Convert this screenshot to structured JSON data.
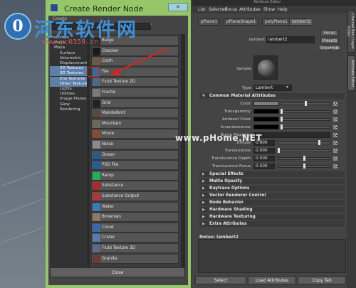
{
  "watermark": {
    "logo_char": "0",
    "text": "河东软件网",
    "url": "www.pc0359.cn",
    "center_text": "www.pHome.NET"
  },
  "render_node": {
    "title": "Create Render Node",
    "create_label": "Create",
    "close_label": "Close",
    "tree": [
      {
        "label": "Favorites",
        "level": 0,
        "selected": false
      },
      {
        "label": "Mava",
        "level": 1,
        "selected": false
      },
      {
        "label": "Maya",
        "level": 1,
        "selected": false
      },
      {
        "label": "Surface",
        "level": 2,
        "selected": false
      },
      {
        "label": "Volumetric",
        "level": 2,
        "selected": false
      },
      {
        "label": "Displacement",
        "level": 2,
        "selected": false
      },
      {
        "label": "2D Textures",
        "level": 2,
        "selected": true
      },
      {
        "label": "3D Textures",
        "level": 2,
        "selected": true
      },
      {
        "label": "Env Textures",
        "level": 2,
        "selected": true
      },
      {
        "label": "Other Textures",
        "level": 2,
        "selected": true
      },
      {
        "label": "Lights",
        "level": 2,
        "selected": false
      },
      {
        "label": "Utilities",
        "level": 2,
        "selected": false
      },
      {
        "label": "Image Planes",
        "level": 2,
        "selected": false
      },
      {
        "label": "Glow",
        "level": 2,
        "selected": false
      },
      {
        "label": "Rendering",
        "level": 2,
        "selected": false
      }
    ],
    "nodes": [
      {
        "label": "Bulge",
        "color": "#2a2a2a",
        "icon": "bulge-icon"
      },
      {
        "label": "Checker",
        "color": "#1a1a1a",
        "icon": "checker-icon"
      },
      {
        "label": "Cloth",
        "color": "#6a5a4a",
        "icon": "cloth-icon"
      },
      {
        "label": "File",
        "color": "#3a6a9a",
        "icon": "file-icon"
      },
      {
        "label": "Fluid Texture 2D",
        "color": "#4a6a8a",
        "icon": "fluid-icon"
      },
      {
        "label": "Fractal",
        "color": "#7a7a7a",
        "icon": "fractal-icon"
      },
      {
        "label": "Grid",
        "color": "#222222",
        "icon": "grid-icon"
      },
      {
        "label": "Mandelbrot",
        "color": "#5a4a3a",
        "icon": "mandelbrot-icon"
      },
      {
        "label": "Mountain",
        "color": "#6a6a5a",
        "icon": "mountain-icon"
      },
      {
        "label": "Movie",
        "color": "#8a4a3a",
        "icon": "movie-icon"
      },
      {
        "label": "Noise",
        "color": "#8a8a8a",
        "icon": "noise-icon"
      },
      {
        "label": "Ocean",
        "color": "#2a5a8a",
        "icon": "ocean-icon"
      },
      {
        "label": "PSD File",
        "color": "#2a5a9a",
        "icon": "psd-icon"
      },
      {
        "label": "Ramp",
        "color": "#2aaa5a",
        "icon": "ramp-icon"
      },
      {
        "label": "Substance",
        "color": "#aa2a2a",
        "icon": "substance-icon"
      },
      {
        "label": "Substance Output",
        "color": "#aa3a3a",
        "icon": "substance-output-icon"
      },
      {
        "label": "Water",
        "color": "#3a7aba",
        "icon": "water-icon"
      },
      {
        "label": "Brownian",
        "color": "#8a7a6a",
        "icon": "brownian-icon"
      },
      {
        "label": "Cloud",
        "color": "#3a6aaa",
        "icon": "cloud-icon"
      },
      {
        "label": "Crater",
        "color": "#5a7aaa",
        "icon": "crater-icon"
      },
      {
        "label": "Fluid Texture 3D",
        "color": "#5a6a8a",
        "icon": "fluid3d-icon"
      },
      {
        "label": "Granite",
        "color": "#6a3a3a",
        "icon": "granite-icon"
      }
    ]
  },
  "attribute_editor": {
    "title": "Attribute Editor",
    "menu": [
      "List",
      "Selected",
      "Focus",
      "Attributes",
      "Show",
      "Help"
    ],
    "tabs": [
      "pPlane1",
      "pPlaneShape1",
      "polyPlane1",
      "lambert2"
    ],
    "node_label": "lambert:",
    "node_value": "lambert2",
    "focus_label": "Focus",
    "presets_label": "Presets",
    "show_label": "Show",
    "hide_label": "Hide",
    "sample_label": "Sample",
    "type_label": "Type",
    "type_value": "Lambert",
    "section_common": "Common Material Attributes",
    "attrs": [
      {
        "label": "Color",
        "value": "",
        "swatch": "#7d7d7d"
      },
      {
        "label": "Transparency",
        "value": "",
        "swatch": "#000000"
      },
      {
        "label": "Ambient Color",
        "value": "",
        "swatch": "#000000"
      },
      {
        "label": "Incandescence",
        "value": "",
        "swatch": "#000000"
      },
      {
        "label": "Bump Mapping",
        "value": "",
        "swatch": ""
      },
      {
        "label": "Diffuse",
        "value": "0.800",
        "swatch": ""
      },
      {
        "label": "Translucence",
        "value": "0.000",
        "swatch": ""
      },
      {
        "label": "Translucence Depth",
        "value": "0.500",
        "swatch": ""
      },
      {
        "label": "Translucence Focus",
        "value": "0.500",
        "swatch": ""
      }
    ],
    "sections": [
      "Special Effects",
      "Matte Opacity",
      "Raytrace Options",
      "Vector Renderer Control",
      "Node Behavior",
      "Hardware Shading",
      "Hardware Texturing",
      "Extra Attributes"
    ],
    "notes_label": "Notes: lambert2",
    "bottom_buttons": [
      "Select",
      "Load Attributes",
      "Copy Tab"
    ],
    "side_tabs": [
      "Channel Box / Layer Editor",
      "Attribute Editor"
    ]
  },
  "colors": {
    "window_frame": "#95c66a",
    "panel": "#444444",
    "selection": "#5d7fa8"
  }
}
